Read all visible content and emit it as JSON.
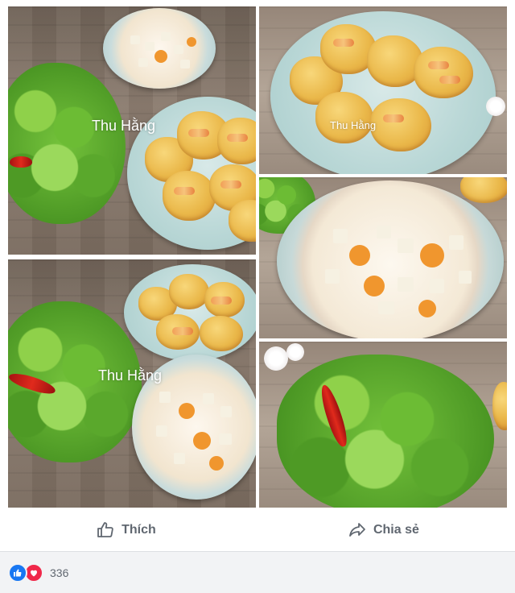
{
  "photos": {
    "watermark": "Thu Hằng"
  },
  "actions": {
    "like_label": "Thích",
    "share_label": "Chia sẻ",
    "like_icon": "thumbs-up-icon",
    "share_icon": "share-arrow-icon"
  },
  "reactions": {
    "count": "336",
    "icons": [
      "like-reaction-icon",
      "love-reaction-icon"
    ],
    "like_color": "#1877f2",
    "love_color": "#f0284a"
  }
}
